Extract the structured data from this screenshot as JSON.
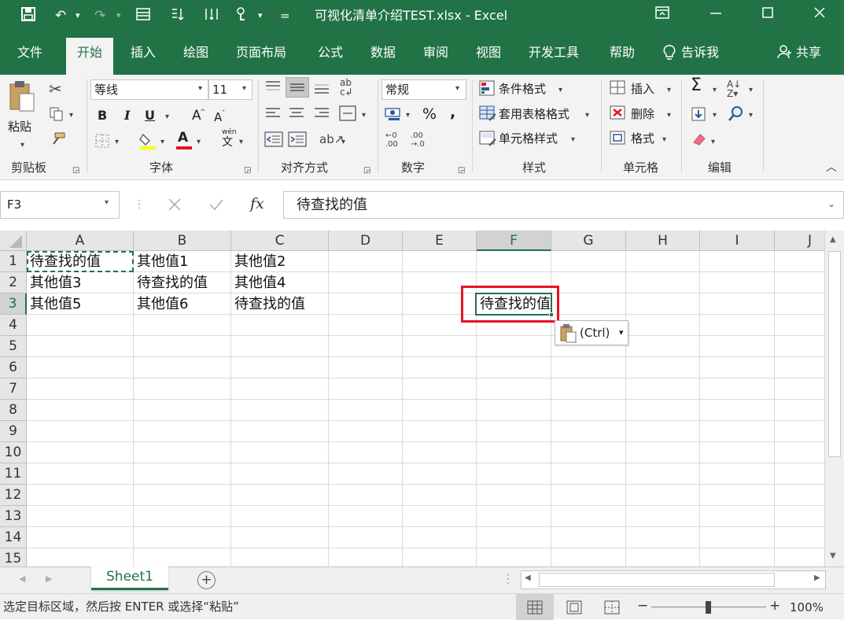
{
  "title_bar": {
    "file_title": "可视化清单介绍TEST.xlsx  -  Excel",
    "qat_more": "="
  },
  "tabs": [
    {
      "label": "文件"
    },
    {
      "label": "开始",
      "active": true
    },
    {
      "label": "插入"
    },
    {
      "label": "绘图"
    },
    {
      "label": "页面布局"
    },
    {
      "label": "公式"
    },
    {
      "label": "数据"
    },
    {
      "label": "审阅"
    },
    {
      "label": "视图"
    },
    {
      "label": "开发工具"
    },
    {
      "label": "帮助"
    }
  ],
  "tell_me": "告诉我",
  "share": "共享",
  "ribbon": {
    "clipboard": {
      "group_label": "剪贴板",
      "paste_label": "粘贴"
    },
    "font": {
      "group_label": "字体",
      "font_name": "等线",
      "font_size": "11",
      "bold": "B",
      "italic": "I",
      "underline": "U",
      "grow": "A",
      "shrink": "A",
      "font_color_letter": "A",
      "wen": "wén",
      "wen_char": "文"
    },
    "alignment": {
      "group_label": "对齐方式"
    },
    "number": {
      "group_label": "数字",
      "format": "常规",
      "percent": "%",
      "comma": ","
    },
    "styles": {
      "group_label": "样式",
      "conditional": "条件格式",
      "table": "套用表格格式",
      "cell_styles": "单元格样式"
    },
    "cells": {
      "group_label": "单元格",
      "insert": "插入",
      "delete": "删除",
      "format": "格式"
    },
    "editing": {
      "group_label": "编辑",
      "sum": "Σ"
    }
  },
  "formula_bar": {
    "name_box": "F3",
    "fx": "fx",
    "value": "待查找的值"
  },
  "columns": [
    "A",
    "B",
    "C",
    "D",
    "E",
    "F",
    "G",
    "H",
    "I",
    "J"
  ],
  "rows": [
    "1",
    "2",
    "3",
    "4",
    "5",
    "6",
    "7",
    "8",
    "9",
    "10",
    "11",
    "12",
    "13",
    "14",
    "15"
  ],
  "cells": {
    "A1": "待查找的值",
    "B1": "其他值1",
    "C1": "其他值2",
    "A2": "其他值3",
    "B2": "待查找的值",
    "C2": "其他值4",
    "A3": "其他值5",
    "B3": "其他值6",
    "C3": "待查找的值",
    "F3": "待查找的值"
  },
  "paste_options": {
    "label": "(Ctrl)"
  },
  "sheets": [
    {
      "label": "Sheet1",
      "active": true
    }
  ],
  "add_sheet": "+",
  "status_bar": {
    "message": "选定目标区域，然后按 ENTER 或选择“粘贴”",
    "zoom": "100%",
    "zoom_minus": "−",
    "zoom_plus": "+"
  },
  "colors": {
    "excel_green": "#217346",
    "highlight_red": "#e81123",
    "ribbon_bg": "#f3f3f3"
  }
}
